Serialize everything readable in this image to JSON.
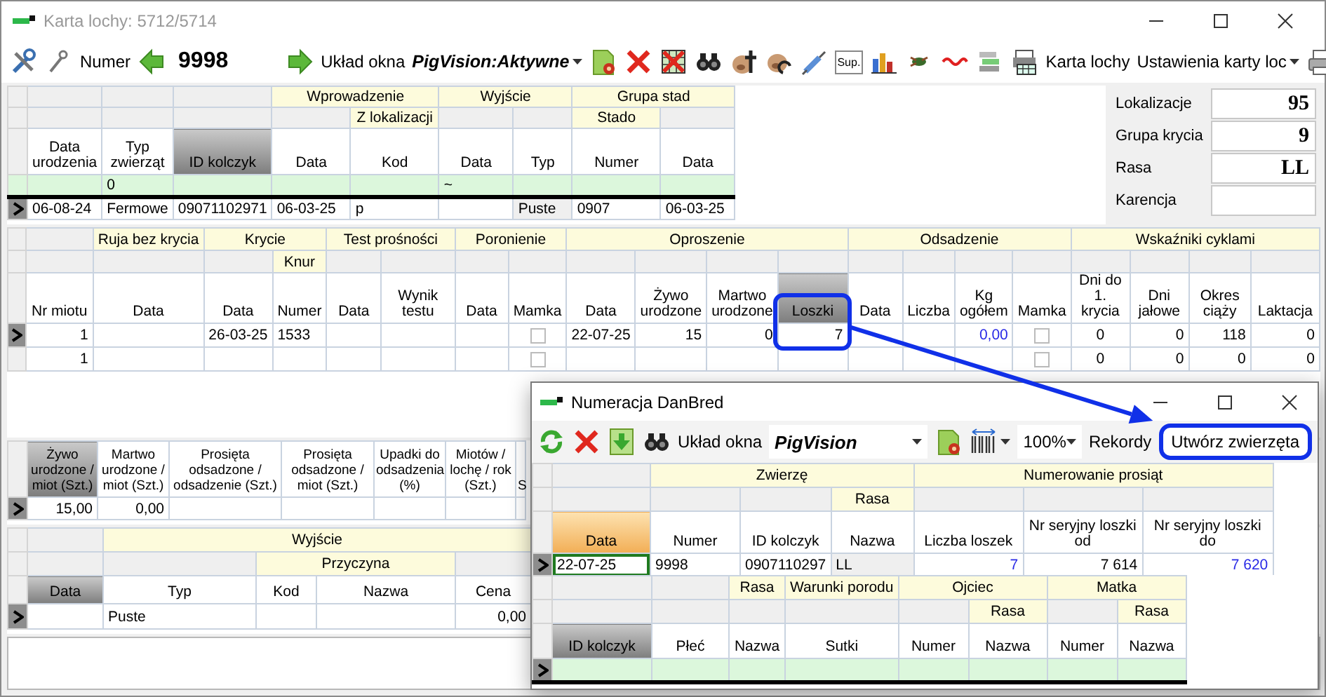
{
  "window": {
    "title": "Karta lochy: 5712/5714"
  },
  "toolbar": {
    "number_label": "Numer",
    "number": "9998",
    "layout_label": "Układ okna",
    "layout_value": "PigVision:Aktywne",
    "sup_label": "Sup.",
    "card_button": "Karta lochy",
    "settings_value": "Ustawienia karty loc"
  },
  "sow_grid": {
    "groups": [
      {
        "subgroups": [
          {
            "columns": [
              {
                "label": "Data urodzenia",
                "sorted": false
              }
            ]
          }
        ]
      },
      {
        "subgroups": [
          {
            "columns": [
              {
                "label": "Typ zwierząt",
                "sorted": false
              }
            ]
          }
        ]
      },
      {
        "subgroups": [
          {
            "columns": [
              {
                "label": "ID kolczyk",
                "sorted": true
              }
            ]
          }
        ]
      },
      {
        "label": "Wprowadzenie",
        "subgroups": [
          {
            "columns": [
              {
                "label": "Data",
                "sorted": false
              }
            ]
          },
          {
            "label": "Z lokalizacji",
            "columns": [
              {
                "label": "Kod",
                "sorted": false
              }
            ]
          }
        ]
      },
      {
        "label": "Wyjście",
        "subgroups": [
          {
            "columns": [
              {
                "label": "Data",
                "sorted": false
              }
            ]
          },
          {
            "columns": [
              {
                "label": "Typ",
                "sorted": false
              }
            ]
          }
        ]
      },
      {
        "label": "Grupa stad",
        "subgroups": [
          {
            "label": "Stado",
            "columns": [
              {
                "label": "Numer",
                "sorted": false
              }
            ]
          },
          {
            "columns": [
              {
                "label": "Data",
                "sorted": false
              }
            ]
          }
        ]
      }
    ],
    "rows": [
      {
        "kind": "new",
        "current": false,
        "cells": [
          null,
          "0",
          null,
          null,
          null,
          "~",
          null,
          null,
          null
        ]
      },
      {
        "kind": "record",
        "current": true,
        "cells": [
          "06-08-24",
          "Fermowe",
          "09071102971",
          "06-03-25",
          "p",
          null,
          {
            "text": "Puste",
            "kind": "readonly"
          },
          "0907",
          "06-03-25"
        ]
      }
    ]
  },
  "info_panel": [
    {
      "label": "Lokalizacje",
      "value": "95"
    },
    {
      "label": "Grupa krycia",
      "value": "9"
    },
    {
      "label": "Rasa",
      "value": "LL"
    },
    {
      "label": "Karencja"
    }
  ],
  "litters_grid": {
    "groups": [
      {
        "subgroups": [
          {
            "columns": [
              {
                "label": "Nr miotu",
                "sorted": false
              }
            ]
          }
        ]
      },
      {
        "label": "Ruja bez krycia",
        "subgroups": [
          {
            "columns": [
              {
                "label": "Data",
                "sorted": false
              }
            ]
          }
        ]
      },
      {
        "label": "Krycie",
        "subgroups": [
          {
            "columns": [
              {
                "label": "Data",
                "sorted": false
              }
            ]
          },
          {
            "label": "Knur",
            "columns": [
              {
                "label": "Numer",
                "sorted": false
              }
            ]
          }
        ]
      },
      {
        "label": "Test prośności",
        "subgroups": [
          {
            "columns": [
              {
                "label": "Data",
                "sorted": false
              }
            ]
          },
          {
            "columns": [
              {
                "label": "Wynik testu",
                "sorted": false
              }
            ]
          }
        ]
      },
      {
        "label": "Poronienie",
        "subgroups": [
          {
            "columns": [
              {
                "label": "Data",
                "sorted": false
              }
            ]
          },
          {
            "columns": [
              {
                "label": "Mamka",
                "sorted": false
              }
            ]
          }
        ]
      },
      {
        "label": "Oproszenie",
        "subgroups": [
          {
            "columns": [
              {
                "label": "Data",
                "sorted": false
              }
            ]
          },
          {
            "columns": [
              {
                "label": "Żywo urodzone",
                "sorted": false
              }
            ]
          },
          {
            "columns": [
              {
                "label": "Martwo urodzone",
                "sorted": false
              }
            ]
          },
          {
            "columns": [
              {
                "label": "Loszki",
                "sorted": true
              }
            ]
          }
        ]
      },
      {
        "label": "Odsadzenie",
        "subgroups": [
          {
            "columns": [
              {
                "label": "Data",
                "sorted": false
              }
            ]
          },
          {
            "columns": [
              {
                "label": "Liczba",
                "sorted": false
              }
            ]
          },
          {
            "columns": [
              {
                "label": "Kg ogółem",
                "sorted": false
              }
            ]
          },
          {
            "columns": [
              {
                "label": "Mamka",
                "sorted": false
              }
            ]
          }
        ]
      },
      {
        "label": "Wskaźniki cyklami",
        "subgroups": [
          {
            "columns": [
              {
                "label": "Dni do 1. krycia",
                "sorted": false
              }
            ]
          },
          {
            "columns": [
              {
                "label": "Dni jałowe",
                "sorted": false
              }
            ]
          },
          {
            "columns": [
              {
                "label": "Okres ciąży",
                "sorted": false
              }
            ]
          },
          {
            "columns": [
              {
                "label": "Laktacja",
                "sorted": false
              }
            ]
          }
        ]
      }
    ],
    "rows": [
      {
        "kind": "record",
        "current": true,
        "cells": [
          "1",
          null,
          "26-03-25",
          "1533",
          null,
          null,
          null,
          {
            "kind": "checkbox",
            "checked": false
          },
          "22-07-25",
          "15",
          "0",
          {
            "text": "7",
            "circled": true
          },
          null,
          null,
          {
            "text": "0,00",
            "kind": "computed"
          },
          {
            "kind": "checkbox",
            "checked": false
          },
          "0",
          "0",
          "118",
          "0"
        ]
      },
      {
        "kind": "record",
        "current": false,
        "cells": [
          "1",
          null,
          null,
          null,
          null,
          null,
          null,
          {
            "kind": "checkbox",
            "checked": false
          },
          null,
          null,
          null,
          null,
          null,
          null,
          null,
          {
            "kind": "checkbox",
            "checked": false
          },
          "0",
          "0",
          "0",
          "0"
        ]
      }
    ]
  },
  "summary_grid": {
    "columns": [
      {
        "label": "Żywo urodzone / miot (Szt.)",
        "sorted": true
      },
      {
        "label": "Martwo urodzone / miot (Szt.)",
        "sorted": false
      },
      {
        "label": "Prosięta odsadzone / odsadzenie (Szt.)",
        "sorted": false
      },
      {
        "label": "Prosięta odsadzone / miot (Szt.)",
        "sorted": false
      },
      {
        "label": "Upadki do odsadzenia (%)",
        "sorted": false
      },
      {
        "label": "Miotów / lochę / rok (Szt.)",
        "sorted": false
      },
      {
        "label": "S",
        "sorted": false
      }
    ],
    "rows": [
      {
        "kind": "record",
        "current": true,
        "cells": [
          "15,00",
          "0,00",
          null,
          null,
          null,
          null,
          null
        ]
      }
    ]
  },
  "exit_grid": {
    "groups": [
      {
        "subgroups": [
          {
            "columns": [
              {
                "label": "Data",
                "sorted": true
              }
            ]
          }
        ]
      },
      {
        "label": "Wyjście",
        "subgroups": [
          {
            "columns": [
              {
                "label": "Typ",
                "sorted": false
              }
            ]
          },
          {
            "label": "Przyczyna",
            "columns": [
              {
                "label": "Kod",
                "sorted": false
              },
              {
                "label": "Nazwa",
                "sorted": false
              }
            ]
          },
          {
            "columns": [
              {
                "label": "Cena",
                "sorted": false
              }
            ]
          }
        ]
      }
    ],
    "rows": [
      {
        "kind": "record",
        "current": true,
        "cells": [
          null,
          "Puste",
          null,
          null,
          "0,00"
        ]
      }
    ]
  },
  "dialog": {
    "title": "Numeracja DanBred",
    "toolbar": {
      "layout_label": "Układ okna",
      "layout_value": "PigVision",
      "zoom_value": "100%",
      "records_label": "Rekordy",
      "create_button": {
        "label": "Utwórz zwierzęta",
        "circled": true
      }
    },
    "numbering_grid": {
      "groups": [
        {
          "subgroups": [
            {
              "columns": [
                {
                  "label": "Data",
                  "sorted": false
                }
              ]
            }
          ]
        },
        {
          "label": "Zwierzę",
          "subgroups": [
            {
              "columns": [
                {
                  "label": "Numer",
                  "sorted": false
                }
              ]
            },
            {
              "columns": [
                {
                  "label": "ID kolczyk",
                  "sorted": false
                }
              ]
            },
            {
              "label": "Rasa",
              "columns": [
                {
                  "label": "Nazwa",
                  "sorted": false
                }
              ]
            }
          ]
        },
        {
          "label": "Numerowanie prosiąt",
          "subgroups": [
            {
              "columns": [
                {
                  "label": "Liczba loszek",
                  "sorted": false
                }
              ]
            },
            {
              "columns": [
                {
                  "label": "Nr seryjny loszki od",
                  "sorted": false
                }
              ]
            },
            {
              "columns": [
                {
                  "label": "Nr seryjny loszki do",
                  "sorted": false
                }
              ]
            }
          ]
        }
      ],
      "rows": [
        {
          "kind": "record",
          "current": true,
          "cells": [
            {
              "text": "22-07-25",
              "focused": true
            },
            "9998",
            "0907110297",
            {
              "text": "LL",
              "kind": "readonly"
            },
            {
              "text": "7",
              "kind": "computed"
            },
            "7 614",
            {
              "text": "7 620",
              "kind": "computed"
            }
          ]
        }
      ]
    },
    "piglets_grid": {
      "groups": [
        {
          "subgroups": [
            {
              "columns": [
                {
                  "label": "ID kolczyk",
                  "sorted": true
                }
              ]
            }
          ]
        },
        {
          "subgroups": [
            {
              "columns": [
                {
                  "label": "Płeć",
                  "sorted": false
                }
              ]
            }
          ]
        },
        {
          "label": "Rasa",
          "subgroups": [
            {
              "columns": [
                {
                  "label": "Nazwa",
                  "sorted": false
                }
              ]
            }
          ]
        },
        {
          "label": "Warunki porodu",
          "subgroups": [
            {
              "columns": [
                {
                  "label": "Sutki",
                  "sorted": false
                }
              ]
            }
          ]
        },
        {
          "label": "Ojciec",
          "subgroups": [
            {
              "columns": [
                {
                  "label": "Numer",
                  "sorted": false
                }
              ]
            },
            {
              "label": "Rasa",
              "columns": [
                {
                  "label": "Nazwa",
                  "sorted": false
                }
              ]
            }
          ]
        },
        {
          "label": "Matka",
          "subgroups": [
            {
              "columns": [
                {
                  "label": "Numer",
                  "sorted": false
                }
              ]
            },
            {
              "label": "Rasa",
              "columns": [
                {
                  "label": "Nazwa",
                  "sorted": false
                }
              ]
            }
          ]
        }
      ],
      "rows": [
        {
          "kind": "new",
          "current": true,
          "cells": [
            null,
            null,
            null,
            null,
            null,
            null,
            null,
            null
          ]
        }
      ]
    }
  },
  "annotation_arrow": true
}
